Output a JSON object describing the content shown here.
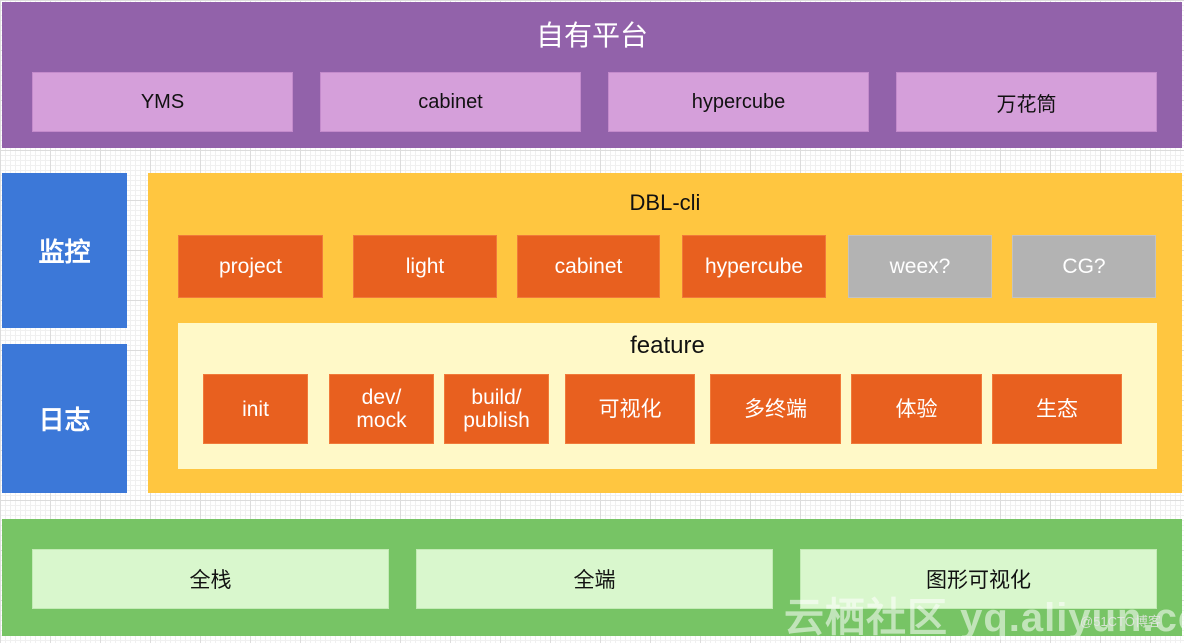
{
  "platform": {
    "title": "自有平台",
    "items": [
      "YMS",
      "cabinet",
      "hypercube",
      "万花筒"
    ]
  },
  "side": {
    "monitor": "监控",
    "log": "日志"
  },
  "cli": {
    "title": "DBL-cli",
    "items": [
      {
        "label": "project",
        "status": "active"
      },
      {
        "label": "light",
        "status": "active"
      },
      {
        "label": "cabinet",
        "status": "active"
      },
      {
        "label": "hypercube",
        "status": "active"
      },
      {
        "label": "weex?",
        "status": "planned"
      },
      {
        "label": "CG?",
        "status": "planned"
      }
    ]
  },
  "feature": {
    "title": "feature",
    "items": [
      "init",
      "dev/\nmock",
      "build/\npublish",
      "可视化",
      "多终端",
      "体验",
      "生态"
    ]
  },
  "foundation": {
    "items": [
      "全栈",
      "全端",
      "图形可视化"
    ]
  },
  "watermark": {
    "main": "云栖社区 yq.aliyun.com",
    "sub": "@51CTO博客"
  },
  "colors": {
    "platform": "#9262aa",
    "platform_item": "#d59fda",
    "side": "#3c78d8",
    "cli": "#ffc640",
    "cli_item_active": "#e8601f",
    "cli_item_planned": "#b3b3b3",
    "feature": "#fff9c8",
    "foundation": "#77c465",
    "foundation_item": "#d9f7cd"
  }
}
